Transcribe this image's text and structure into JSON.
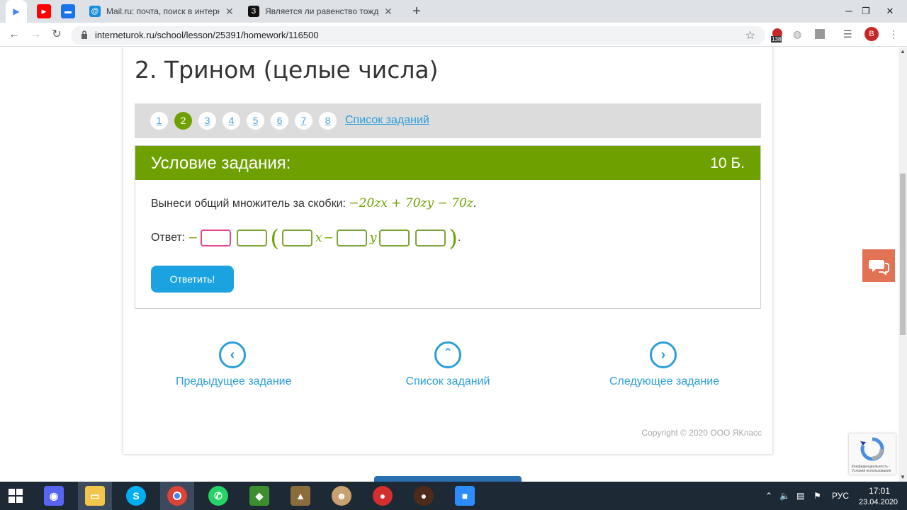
{
  "browser": {
    "tabs": [
      {
        "title": "Mail.ru: почта, поиск в интерне"
      },
      {
        "title": "Является ли равенство тождест"
      }
    ],
    "url": "interneturok.ru/school/lesson/25391/homework/116500",
    "ext_badge": "138",
    "profile_initial": "В"
  },
  "page": {
    "title": "2. Трином (целые числа)",
    "pager": [
      "1",
      "2",
      "3",
      "4",
      "5",
      "6",
      "7",
      "8"
    ],
    "current_page": "2",
    "tasklist_link": "Список заданий",
    "task": {
      "header": "Условие задания:",
      "points": "10 Б.",
      "condition_text": "Вынеси общий множитель за скобки:",
      "condition_math": "−20zx + 70zy − 70z",
      "condition_end": ".",
      "answer_label": "Ответ:",
      "minus": "−",
      "var_x": "x",
      "minus2": "−",
      "var_y": "y",
      "end": ".",
      "submit": "Ответить!"
    },
    "nav": {
      "prev": "Предыдущее задание",
      "list": "Список заданий",
      "next": "Следующее задание"
    },
    "copyright": "Copyright © 2020 ООО ЯКласс",
    "recaptcha_text": "Конфиденциальность - Условия использования"
  },
  "taskbar": {
    "lang": "РУС",
    "time": "17:01",
    "date": "23.04.2020"
  }
}
